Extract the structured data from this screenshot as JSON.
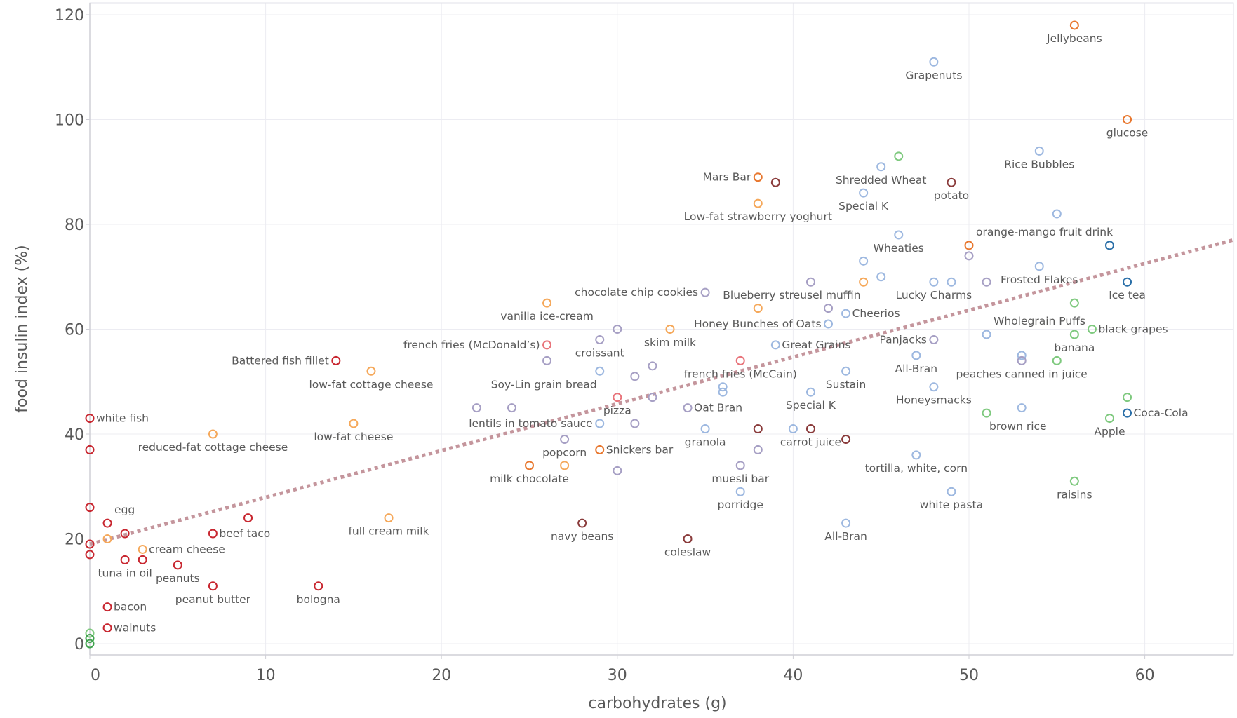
{
  "chart_data": {
    "type": "scatter",
    "title": "",
    "xlabel": "carbohydrates (g)",
    "ylabel": "food insulin index (%)",
    "xlim": [
      0,
      65
    ],
    "ylim": [
      -2,
      122
    ],
    "xticks": [
      0,
      10,
      20,
      30,
      40,
      50,
      60
    ],
    "yticks": [
      0,
      20,
      40,
      60,
      80,
      100,
      120
    ],
    "grid": true,
    "legend": "none",
    "trendline": {
      "style": "dotted",
      "color": "#c4959c",
      "from": [
        0,
        19
      ],
      "to": [
        65,
        77
      ]
    },
    "category_colors": {
      "protein": "#c8262f",
      "dairy": "#f5a85a",
      "sweet": "#e8772e",
      "grain_purple": "#a69fc4",
      "cereal": "#9db8e0",
      "fastfood": "#e8737a",
      "vegetable": "#8a3b3b",
      "fruit": "#7ec97e",
      "drink": "#2a6fa8",
      "nuts_green": "#3fa34d"
    },
    "points": [
      {
        "x": 56,
        "y": 118,
        "cat": "sweet",
        "label": "Jellybeans",
        "pos": "below"
      },
      {
        "x": 48,
        "y": 111,
        "cat": "cereal",
        "label": "Grapenuts",
        "pos": "below"
      },
      {
        "x": 59,
        "y": 100,
        "cat": "sweet",
        "label": "glucose",
        "pos": "below"
      },
      {
        "x": 54,
        "y": 94,
        "cat": "cereal",
        "label": "Rice Bubbles",
        "pos": "below"
      },
      {
        "x": 38,
        "y": 89,
        "cat": "sweet",
        "label": "Mars Bar",
        "pos": "left"
      },
      {
        "x": 39,
        "y": 88,
        "cat": "vegetable",
        "label": "",
        "pos": ""
      },
      {
        "x": 46,
        "y": 93,
        "cat": "fruit",
        "label": "",
        "pos": ""
      },
      {
        "x": 45,
        "y": 91,
        "cat": "cereal",
        "label": "Shredded Wheat",
        "pos": "below"
      },
      {
        "x": 44,
        "y": 86,
        "cat": "cereal",
        "label": "Special K",
        "pos": "below"
      },
      {
        "x": 49,
        "y": 88,
        "cat": "vegetable",
        "label": "potato",
        "pos": "below"
      },
      {
        "x": 38,
        "y": 84,
        "cat": "dairy",
        "label": "Low-fat strawberry yoghurt",
        "pos": "below"
      },
      {
        "x": 55,
        "y": 82,
        "cat": "cereal",
        "label": "",
        "pos": ""
      },
      {
        "x": 46,
        "y": 78,
        "cat": "cereal",
        "label": "Wheaties",
        "pos": "below"
      },
      {
        "x": 50,
        "y": 76,
        "cat": "sweet",
        "label": "orange-mango fruit drink",
        "pos": "aboveright"
      },
      {
        "x": 50,
        "y": 74,
        "cat": "grain_purple",
        "label": "",
        "pos": ""
      },
      {
        "x": 58,
        "y": 76,
        "cat": "drink",
        "label": "",
        "pos": ""
      },
      {
        "x": 44,
        "y": 73,
        "cat": "cereal",
        "label": "",
        "pos": ""
      },
      {
        "x": 45,
        "y": 70,
        "cat": "cereal",
        "label": "",
        "pos": ""
      },
      {
        "x": 44,
        "y": 69,
        "cat": "dairy",
        "label": "Blueberry streusel muffin",
        "pos": "belowleft"
      },
      {
        "x": 41,
        "y": 69,
        "cat": "grain_purple",
        "label": "",
        "pos": ""
      },
      {
        "x": 48,
        "y": 69,
        "cat": "cereal",
        "label": "Lucky Charms",
        "pos": "below"
      },
      {
        "x": 49,
        "y": 69,
        "cat": "cereal",
        "label": "",
        "pos": ""
      },
      {
        "x": 51,
        "y": 69,
        "cat": "grain_purple",
        "label": "",
        "pos": ""
      },
      {
        "x": 54,
        "y": 72,
        "cat": "cereal",
        "label": "Frosted Flakes",
        "pos": "below"
      },
      {
        "x": 59,
        "y": 69,
        "cat": "drink",
        "label": "Ice tea",
        "pos": "below"
      },
      {
        "x": 35,
        "y": 67,
        "cat": "grain_purple",
        "label": "chocolate chip cookies",
        "pos": "left"
      },
      {
        "x": 26,
        "y": 65,
        "cat": "dairy",
        "label": "vanilla ice-cream",
        "pos": "below"
      },
      {
        "x": 38,
        "y": 64,
        "cat": "dairy",
        "label": "",
        "pos": ""
      },
      {
        "x": 42,
        "y": 64,
        "cat": "grain_purple",
        "label": "",
        "pos": ""
      },
      {
        "x": 42,
        "y": 61,
        "cat": "cereal",
        "label": "Honey Bunches of Oats",
        "pos": "left"
      },
      {
        "x": 43,
        "y": 63,
        "cat": "cereal",
        "label": "Cheerios",
        "pos": "right"
      },
      {
        "x": 56,
        "y": 65,
        "cat": "fruit",
        "label": "",
        "pos": ""
      },
      {
        "x": 51,
        "y": 59,
        "cat": "cereal",
        "label": "Wholegrain Puffs",
        "pos": "aboveright"
      },
      {
        "x": 57,
        "y": 60,
        "cat": "fruit",
        "label": "black grapes",
        "pos": "right"
      },
      {
        "x": 56,
        "y": 59,
        "cat": "fruit",
        "label": "banana",
        "pos": "below"
      },
      {
        "x": 33,
        "y": 60,
        "cat": "dairy",
        "label": "skim milk",
        "pos": "below"
      },
      {
        "x": 30,
        "y": 60,
        "cat": "grain_purple",
        "label": "",
        "pos": ""
      },
      {
        "x": 29,
        "y": 58,
        "cat": "grain_purple",
        "label": "croissant",
        "pos": "below"
      },
      {
        "x": 26,
        "y": 57,
        "cat": "fastfood",
        "label": "french fries (McDonald’s)",
        "pos": "left"
      },
      {
        "x": 39,
        "y": 57,
        "cat": "cereal",
        "label": "Great Grains",
        "pos": "right"
      },
      {
        "x": 48,
        "y": 58,
        "cat": "grain_purple",
        "label": "Panjacks",
        "pos": "left"
      },
      {
        "x": 26,
        "y": 54,
        "cat": "grain_purple",
        "label": "",
        "pos": ""
      },
      {
        "x": 37,
        "y": 54,
        "cat": "fastfood",
        "label": "french fries (McCain)",
        "pos": "below"
      },
      {
        "x": 32,
        "y": 53,
        "cat": "grain_purple",
        "label": "",
        "pos": ""
      },
      {
        "x": 31,
        "y": 51,
        "cat": "grain_purple",
        "label": "",
        "pos": ""
      },
      {
        "x": 29,
        "y": 52,
        "cat": "cereal",
        "label": "Soy-Lin grain bread",
        "pos": "belowleft"
      },
      {
        "x": 47,
        "y": 55,
        "cat": "cereal",
        "label": "All-Bran",
        "pos": "below"
      },
      {
        "x": 53,
        "y": 55,
        "cat": "cereal",
        "label": "",
        "pos": ""
      },
      {
        "x": 53,
        "y": 54,
        "cat": "grain_purple",
        "label": "peaches canned in juice",
        "pos": "below"
      },
      {
        "x": 55,
        "y": 54,
        "cat": "fruit",
        "label": "",
        "pos": ""
      },
      {
        "x": 43,
        "y": 52,
        "cat": "cereal",
        "label": "Sustain",
        "pos": "below"
      },
      {
        "x": 48,
        "y": 49,
        "cat": "cereal",
        "label": "Honeysmacks",
        "pos": "below"
      },
      {
        "x": 36,
        "y": 49,
        "cat": "cereal",
        "label": "",
        "pos": ""
      },
      {
        "x": 36,
        "y": 48,
        "cat": "cereal",
        "label": "",
        "pos": ""
      },
      {
        "x": 41,
        "y": 48,
        "cat": "cereal",
        "label": "Special K",
        "pos": "below"
      },
      {
        "x": 30,
        "y": 47,
        "cat": "fastfood",
        "label": "pizza",
        "pos": "below"
      },
      {
        "x": 32,
        "y": 47,
        "cat": "grain_purple",
        "label": "",
        "pos": ""
      },
      {
        "x": 34,
        "y": 45,
        "cat": "grain_purple",
        "label": "Oat Bran",
        "pos": "right"
      },
      {
        "x": 22,
        "y": 45,
        "cat": "grain_purple",
        "label": "",
        "pos": ""
      },
      {
        "x": 24,
        "y": 45,
        "cat": "grain_purple",
        "label": "",
        "pos": ""
      },
      {
        "x": 29,
        "y": 42,
        "cat": "cereal",
        "label": "lentils in tomato sauce",
        "pos": "left"
      },
      {
        "x": 31,
        "y": 42,
        "cat": "grain_purple",
        "label": "",
        "pos": ""
      },
      {
        "x": 14,
        "y": 54,
        "cat": "protein",
        "label": "Battered fish fillet",
        "pos": "left"
      },
      {
        "x": 16,
        "y": 52,
        "cat": "dairy",
        "label": "low-fat cottage cheese",
        "pos": "below"
      },
      {
        "x": 15,
        "y": 42,
        "cat": "dairy",
        "label": "low-fat cheese",
        "pos": "below"
      },
      {
        "x": 0,
        "y": 43,
        "cat": "protein",
        "label": "white fish",
        "pos": "right"
      },
      {
        "x": 7,
        "y": 40,
        "cat": "dairy",
        "label": "reduced-fat cottage cheese",
        "pos": "below"
      },
      {
        "x": 0,
        "y": 37,
        "cat": "protein",
        "label": "",
        "pos": ""
      },
      {
        "x": 35,
        "y": 41,
        "cat": "cereal",
        "label": "granola",
        "pos": "below"
      },
      {
        "x": 38,
        "y": 41,
        "cat": "vegetable",
        "label": "",
        "pos": ""
      },
      {
        "x": 40,
        "y": 41,
        "cat": "cereal",
        "label": "",
        "pos": ""
      },
      {
        "x": 41,
        "y": 41,
        "cat": "vegetable",
        "label": "carrot juice",
        "pos": "below"
      },
      {
        "x": 43,
        "y": 39,
        "cat": "vegetable",
        "label": "",
        "pos": ""
      },
      {
        "x": 27,
        "y": 39,
        "cat": "grain_purple",
        "label": "popcorn",
        "pos": "below"
      },
      {
        "x": 29,
        "y": 37,
        "cat": "sweet",
        "label": "Snickers bar",
        "pos": "right"
      },
      {
        "x": 38,
        "y": 37,
        "cat": "grain_purple",
        "label": "",
        "pos": ""
      },
      {
        "x": 25,
        "y": 34,
        "cat": "sweet",
        "label": "milk chocolate",
        "pos": "below"
      },
      {
        "x": 27,
        "y": 34,
        "cat": "dairy",
        "label": "",
        "pos": ""
      },
      {
        "x": 30,
        "y": 33,
        "cat": "grain_purple",
        "label": "",
        "pos": ""
      },
      {
        "x": 37,
        "y": 34,
        "cat": "grain_purple",
        "label": "muesli bar",
        "pos": "below"
      },
      {
        "x": 47,
        "y": 36,
        "cat": "cereal",
        "label": "tortilla, white, corn",
        "pos": "below"
      },
      {
        "x": 51,
        "y": 44,
        "cat": "fruit",
        "label": "brown rice",
        "pos": "belowright"
      },
      {
        "x": 53,
        "y": 45,
        "cat": "cereal",
        "label": "",
        "pos": ""
      },
      {
        "x": 58,
        "y": 43,
        "cat": "fruit",
        "label": "Apple",
        "pos": "below"
      },
      {
        "x": 59,
        "y": 44,
        "cat": "drink",
        "label": "Coca-Cola",
        "pos": "right"
      },
      {
        "x": 59,
        "y": 47,
        "cat": "fruit",
        "label": "",
        "pos": ""
      },
      {
        "x": 56,
        "y": 31,
        "cat": "fruit",
        "label": "raisins",
        "pos": "below"
      },
      {
        "x": 37,
        "y": 29,
        "cat": "cereal",
        "label": "porridge",
        "pos": "below"
      },
      {
        "x": 49,
        "y": 29,
        "cat": "cereal",
        "label": "white pasta",
        "pos": "below"
      },
      {
        "x": 1,
        "y": 23,
        "cat": "protein",
        "label": "egg",
        "pos": "aboveright"
      },
      {
        "x": 0,
        "y": 26,
        "cat": "protein",
        "label": "",
        "pos": ""
      },
      {
        "x": 7,
        "y": 21,
        "cat": "protein",
        "label": "beef taco",
        "pos": "right"
      },
      {
        "x": 9,
        "y": 24,
        "cat": "protein",
        "label": "",
        "pos": ""
      },
      {
        "x": 2,
        "y": 21,
        "cat": "protein",
        "label": "",
        "pos": ""
      },
      {
        "x": 1,
        "y": 20,
        "cat": "dairy",
        "label": "",
        "pos": ""
      },
      {
        "x": 0,
        "y": 19,
        "cat": "protein",
        "label": "",
        "pos": ""
      },
      {
        "x": 0,
        "y": 17,
        "cat": "protein",
        "label": "",
        "pos": ""
      },
      {
        "x": 17,
        "y": 24,
        "cat": "dairy",
        "label": "full cream milk",
        "pos": "below"
      },
      {
        "x": 28,
        "y": 23,
        "cat": "vegetable",
        "label": "navy beans",
        "pos": "below"
      },
      {
        "x": 43,
        "y": 23,
        "cat": "cereal",
        "label": "All-Bran",
        "pos": "below"
      },
      {
        "x": 34,
        "y": 20,
        "cat": "vegetable",
        "label": "coleslaw",
        "pos": "below"
      },
      {
        "x": 3,
        "y": 18,
        "cat": "dairy",
        "label": "cream cheese",
        "pos": "right"
      },
      {
        "x": 2,
        "y": 16,
        "cat": "protein",
        "label": "tuna in oil",
        "pos": "below"
      },
      {
        "x": 3,
        "y": 16,
        "cat": "protein",
        "label": "",
        "pos": ""
      },
      {
        "x": 5,
        "y": 15,
        "cat": "protein",
        "label": "peanuts",
        "pos": "below"
      },
      {
        "x": 7,
        "y": 11,
        "cat": "protein",
        "label": "peanut butter",
        "pos": "below"
      },
      {
        "x": 13,
        "y": 11,
        "cat": "protein",
        "label": "bologna",
        "pos": "below"
      },
      {
        "x": 1,
        "y": 7,
        "cat": "protein",
        "label": "bacon",
        "pos": "right"
      },
      {
        "x": 1,
        "y": 3,
        "cat": "protein",
        "label": "walnuts",
        "pos": "right"
      },
      {
        "x": 0,
        "y": 2,
        "cat": "fruit",
        "label": "",
        "pos": ""
      },
      {
        "x": 0,
        "y": 1,
        "cat": "nuts_green",
        "label": "",
        "pos": ""
      },
      {
        "x": 0,
        "y": 0,
        "cat": "nuts_green",
        "label": "",
        "pos": ""
      }
    ]
  }
}
